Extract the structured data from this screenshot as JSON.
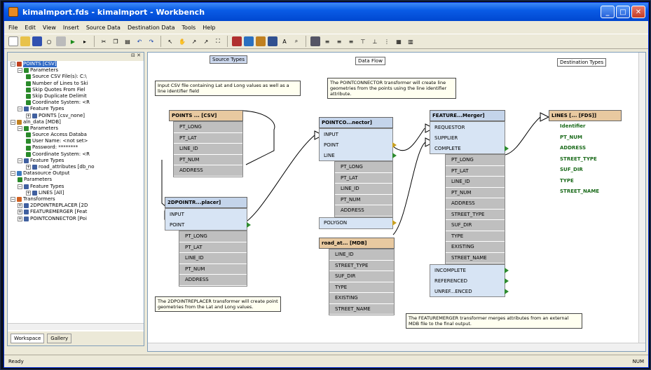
{
  "window": {
    "title": "kimalmport.fds - kimalmport - Workbench"
  },
  "menu": [
    "File",
    "Edit",
    "View",
    "Insert",
    "Source Data",
    "Destination Data",
    "Tools",
    "Help"
  ],
  "left_panel": {
    "tabs": [
      "Workspace",
      "Gallery"
    ],
    "tree": [
      "POINTS [CSV]",
      "Parameters",
      "Source CSV File(s): C:\\",
      "Number of Lines to Ski",
      "Skip Quotes From Fiel",
      "Skip Duplicate Delimit",
      "Coordinate System: <R",
      "Feature Types",
      "POINTS [csv_none]",
      "aln_data [MDB]",
      "Parameters",
      "Source Access Databa",
      "User Name: <not set>",
      "Password: ********",
      "Coordinate System: <R",
      "Feature Types",
      "road_attributes [db_no",
      "Datasource Output",
      "Parameters",
      "Feature Types",
      "LINES [All]",
      "Transformers",
      "2DPOINTREPLACER [2D",
      "FEATUREMERGER [Feat",
      "POINTCONNECTOR [Poi"
    ]
  },
  "canvas": {
    "headers": {
      "source": "Source Types",
      "flow": "Data Flow",
      "dest": "Destination Types"
    },
    "notes": {
      "csv": "Input CSV file containing Lat and Long values as well as a line identifier field",
      "connector": "The POINTCONNECTOR transformer will create line geometries from the points using the line identifier attribute.",
      "replacer": "The 2DPOINTREPLACER transformer will create point geometries from the Lat and Long values.",
      "merger": "The FEATUREMERGER transformer merges attributes from an external MDB file to the final output."
    },
    "points_node": {
      "title": "POINTS ... [CSV]",
      "rows": [
        "PT_LONG",
        "PT_LAT",
        "LINE_ID",
        "PT_NUM",
        "ADDRESS"
      ]
    },
    "replacer_node": {
      "title": "2DPOINTR...placer]",
      "ports": [
        "INPUT",
        "POINT"
      ],
      "rows": [
        "PT_LONG",
        "PT_LAT",
        "LINE_ID",
        "PT_NUM",
        "ADDRESS"
      ]
    },
    "connector_node": {
      "title": "POINTCO...nector]",
      "ports": [
        "INPUT",
        "POINT",
        "LINE",
        "POLYGON"
      ],
      "rows": [
        "PT_LONG",
        "PT_LAT",
        "LINE_ID",
        "PT_NUM",
        "ADDRESS"
      ]
    },
    "road_node": {
      "title": "road_at... [MDB]",
      "rows": [
        "LINE_ID",
        "STREET_TYPE",
        "SUF_DIR",
        "TYPE",
        "EXISTING",
        "STREET_NAME"
      ]
    },
    "merger_node": {
      "title": "FEATURE...Merger]",
      "ports_in": [
        "REQUESTOR",
        "SUPPLIER",
        "COMPLETE"
      ],
      "rows": [
        "PT_LONG",
        "PT_LAT",
        "LINE_ID",
        "PT_NUM",
        "ADDRESS",
        "STREET_TYPE",
        "SUF_DIR",
        "TYPE",
        "EXISTING",
        "STREET_NAME"
      ],
      "ports_out": [
        "INCOMPLETE",
        "REFERENCED",
        "UNREF...ENCED"
      ]
    },
    "lines_node": {
      "title": "LINES [... [FDS]]",
      "rows": [
        "Identifier",
        "PT_NUM",
        "ADDRESS",
        "STREET_TYPE",
        "SUF_DIR",
        "TYPE",
        "STREET_NAME"
      ]
    }
  },
  "status": {
    "left": "Ready",
    "right": "NUM"
  }
}
